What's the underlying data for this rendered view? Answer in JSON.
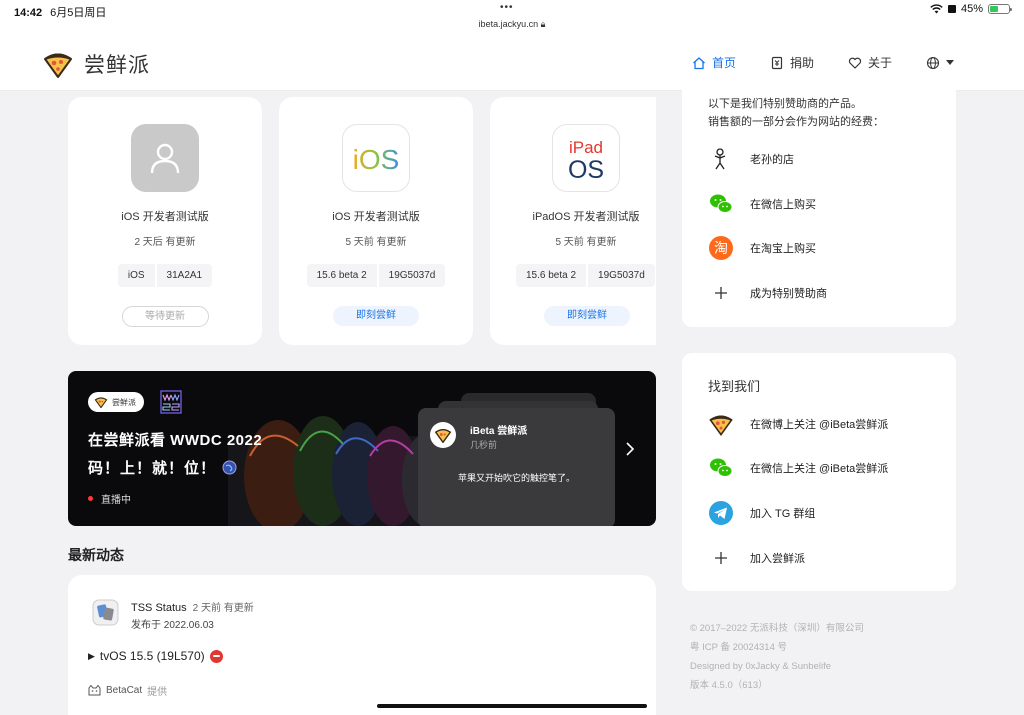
{
  "status": {
    "time": "14:42",
    "date": "6月5日周日",
    "url": "ibeta.jackyu.cn",
    "battery": "45%",
    "battery_level": 0.45
  },
  "header": {
    "logo_text": "尝鲜派",
    "nav": [
      {
        "label": "首页",
        "icon": "home-icon"
      },
      {
        "label": "捐助",
        "icon": "donate-icon"
      },
      {
        "label": "关于",
        "icon": "heart-icon"
      }
    ],
    "lang_icon": "globe-icon"
  },
  "releases": [
    {
      "name": "iOS 开发者测试版",
      "status": "2 天后 有更新",
      "version": "iOS",
      "build": "31A2A1",
      "button": "等待更新",
      "icon": "placeholder-icon"
    },
    {
      "name": "iOS 开发者测试版",
      "status": "5 天前 有更新",
      "version": "15.6 beta 2",
      "build": "19G5037d",
      "button": "即刻尝鲜",
      "icon": "ios-icon",
      "icon_text": "iOS"
    },
    {
      "name": "iPadOS 开发者测试版",
      "status": "5 天前 有更新",
      "version": "15.6 beta 2",
      "build": "19G5037d",
      "button": "即刻尝鲜",
      "icon": "ipados-icon",
      "icon_text_top": "iPad",
      "icon_text_bottom": "OS"
    }
  ],
  "banner": {
    "badge": "尝鲜派",
    "title": "在尝鲜派看 WWDC 2022",
    "subtitle": "码！上！就！位！",
    "live": "直播中",
    "notification": {
      "name": "iBeta 尝鲜派",
      "time": "几秒前",
      "text": "苹果又开始吹它的触控笔了。"
    }
  },
  "feed": {
    "title": "最新动态",
    "item": {
      "name": "TSS Status",
      "updated": "2 天前 有更新",
      "published": "发布于 2022.06.03",
      "entry": "tvOS 15.5 (19L570)",
      "source": "BetaCat",
      "source_suffix": "提供"
    }
  },
  "sponsors": {
    "intro_line1": "以下是我们特别赞助商的产品。",
    "intro_line2": "销售额的一部分会作为网站的经费：",
    "items": [
      "老孙的店",
      "在微信上购买",
      "在淘宝上购买",
      "成为特别赞助商"
    ],
    "taobao_glyph": "淘"
  },
  "find_us": {
    "title": "找到我们",
    "items": [
      "在微博上关注 @iBeta尝鲜派",
      "在微信上关注 @iBeta尝鲜派",
      "加入 TG 群组",
      "加入尝鲜派"
    ]
  },
  "footer": [
    "© 2017–2022 无派科技（深圳）有限公司",
    "粤 ICP 备 20024314 号",
    "Designed by 0xJacky & Sunbelife",
    "版本 4.5.0（613）"
  ]
}
